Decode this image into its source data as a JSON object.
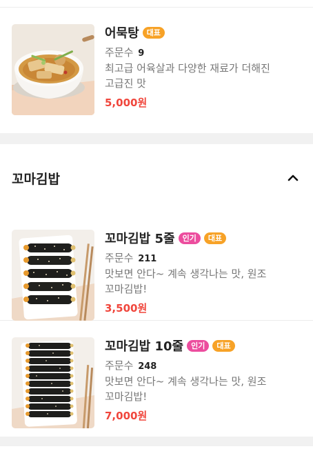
{
  "items_top": {
    "name": "어묵탕",
    "badges": [
      "대표"
    ],
    "orders_label": "주문수",
    "orders_count": "9",
    "description": "최고급 어육살과 다양한 재료가 더해진 고급진 맛",
    "price": "5,000원"
  },
  "section": {
    "title": "꼬마김밥",
    "collapse_icon": "chevron-up-icon",
    "items": [
      {
        "name": "꼬마김밥 5줄",
        "badge_popular": "인기",
        "badge_rep": "대표",
        "orders_label": "주문수",
        "orders_count": "211",
        "description": "맛보면 안다~ 계속 생각나는 맛, 원조 꼬마김밥!",
        "price": "3,500원"
      },
      {
        "name": "꼬마김밥 10줄",
        "badge_popular": "인기",
        "badge_rep": "대표",
        "orders_label": "주문수",
        "orders_count": "248",
        "description": "맛보면 안다~ 계속 생각나는 맛, 원조 꼬마김밥!",
        "price": "7,000원"
      }
    ]
  },
  "colors": {
    "price": "#f0463c",
    "badge_popular": "#ec4d9e",
    "badge_rep": "#f7a227"
  }
}
